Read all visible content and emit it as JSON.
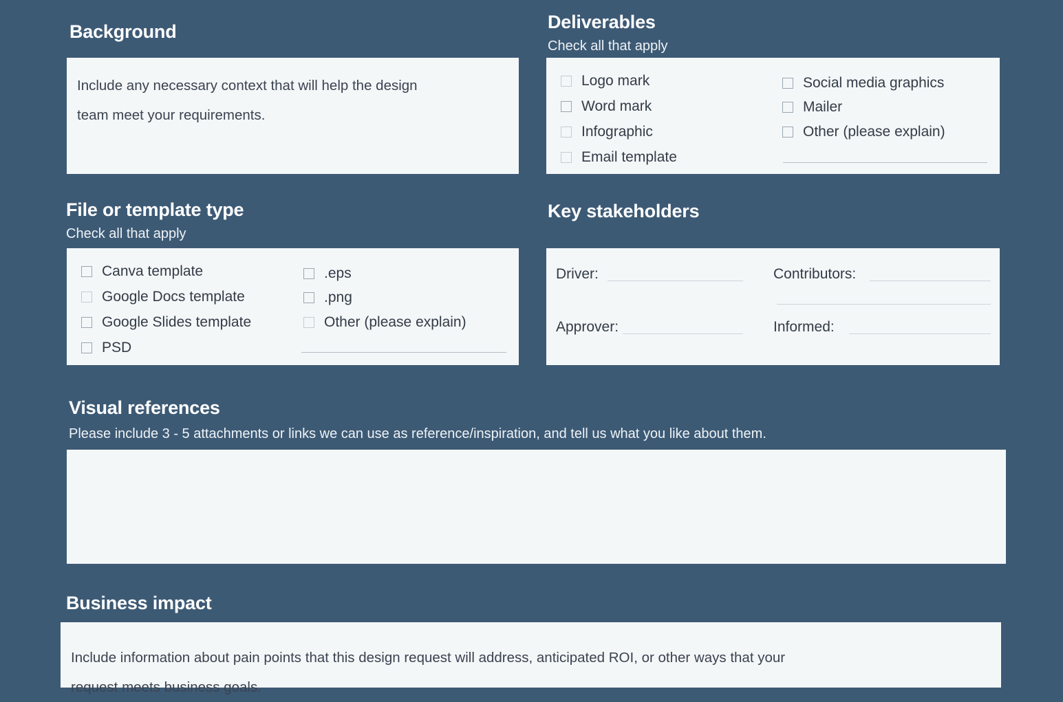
{
  "theme": {
    "page_background": "#3d5a75",
    "card_background": "#f4f7f8",
    "heading_color": "#ffffff",
    "body_text_color": "#333b47",
    "rule_color": "#b4bcc4",
    "checkbox_border": "#c3cbd2"
  },
  "sections": {
    "background": {
      "title": "Background",
      "body_line1": "Include any necessary context that will help the design",
      "body_line2": "team meet your requirements."
    },
    "deliverables": {
      "title": "Deliverables",
      "subtitle": "Check all that apply",
      "left_options": [
        "Logo mark",
        "Word mark",
        "Infographic",
        "Email template"
      ],
      "right_options": [
        "Social media graphics",
        "Mailer",
        "Other (please explain)"
      ]
    },
    "file_or_template_type": {
      "title": "File or template type",
      "subtitle": "Check all that apply",
      "left_options": [
        "Canva template",
        "Google Docs template",
        "Google Slides template",
        "PSD"
      ],
      "right_options": [
        ".eps",
        ".png",
        "Other (please explain)"
      ]
    },
    "key_stakeholders": {
      "title": "Key stakeholders",
      "fields": [
        {
          "label": "Driver:",
          "value": ""
        },
        {
          "label": "Contributors:",
          "value": ""
        },
        {
          "label": "Approver:",
          "value": ""
        },
        {
          "label": "Informed:",
          "value": ""
        }
      ]
    },
    "visual_references": {
      "title": "Visual references",
      "subtitle": "Please include 3 - 5 attachments or links we can use as reference/inspiration, and tell us what you like about them.",
      "value": ""
    },
    "business_impact": {
      "title": "Business impact",
      "body_line1": "Include information about pain points that this design request will address, anticipated ROI, or other ways that your",
      "body_line2": "request meets business goals."
    }
  }
}
